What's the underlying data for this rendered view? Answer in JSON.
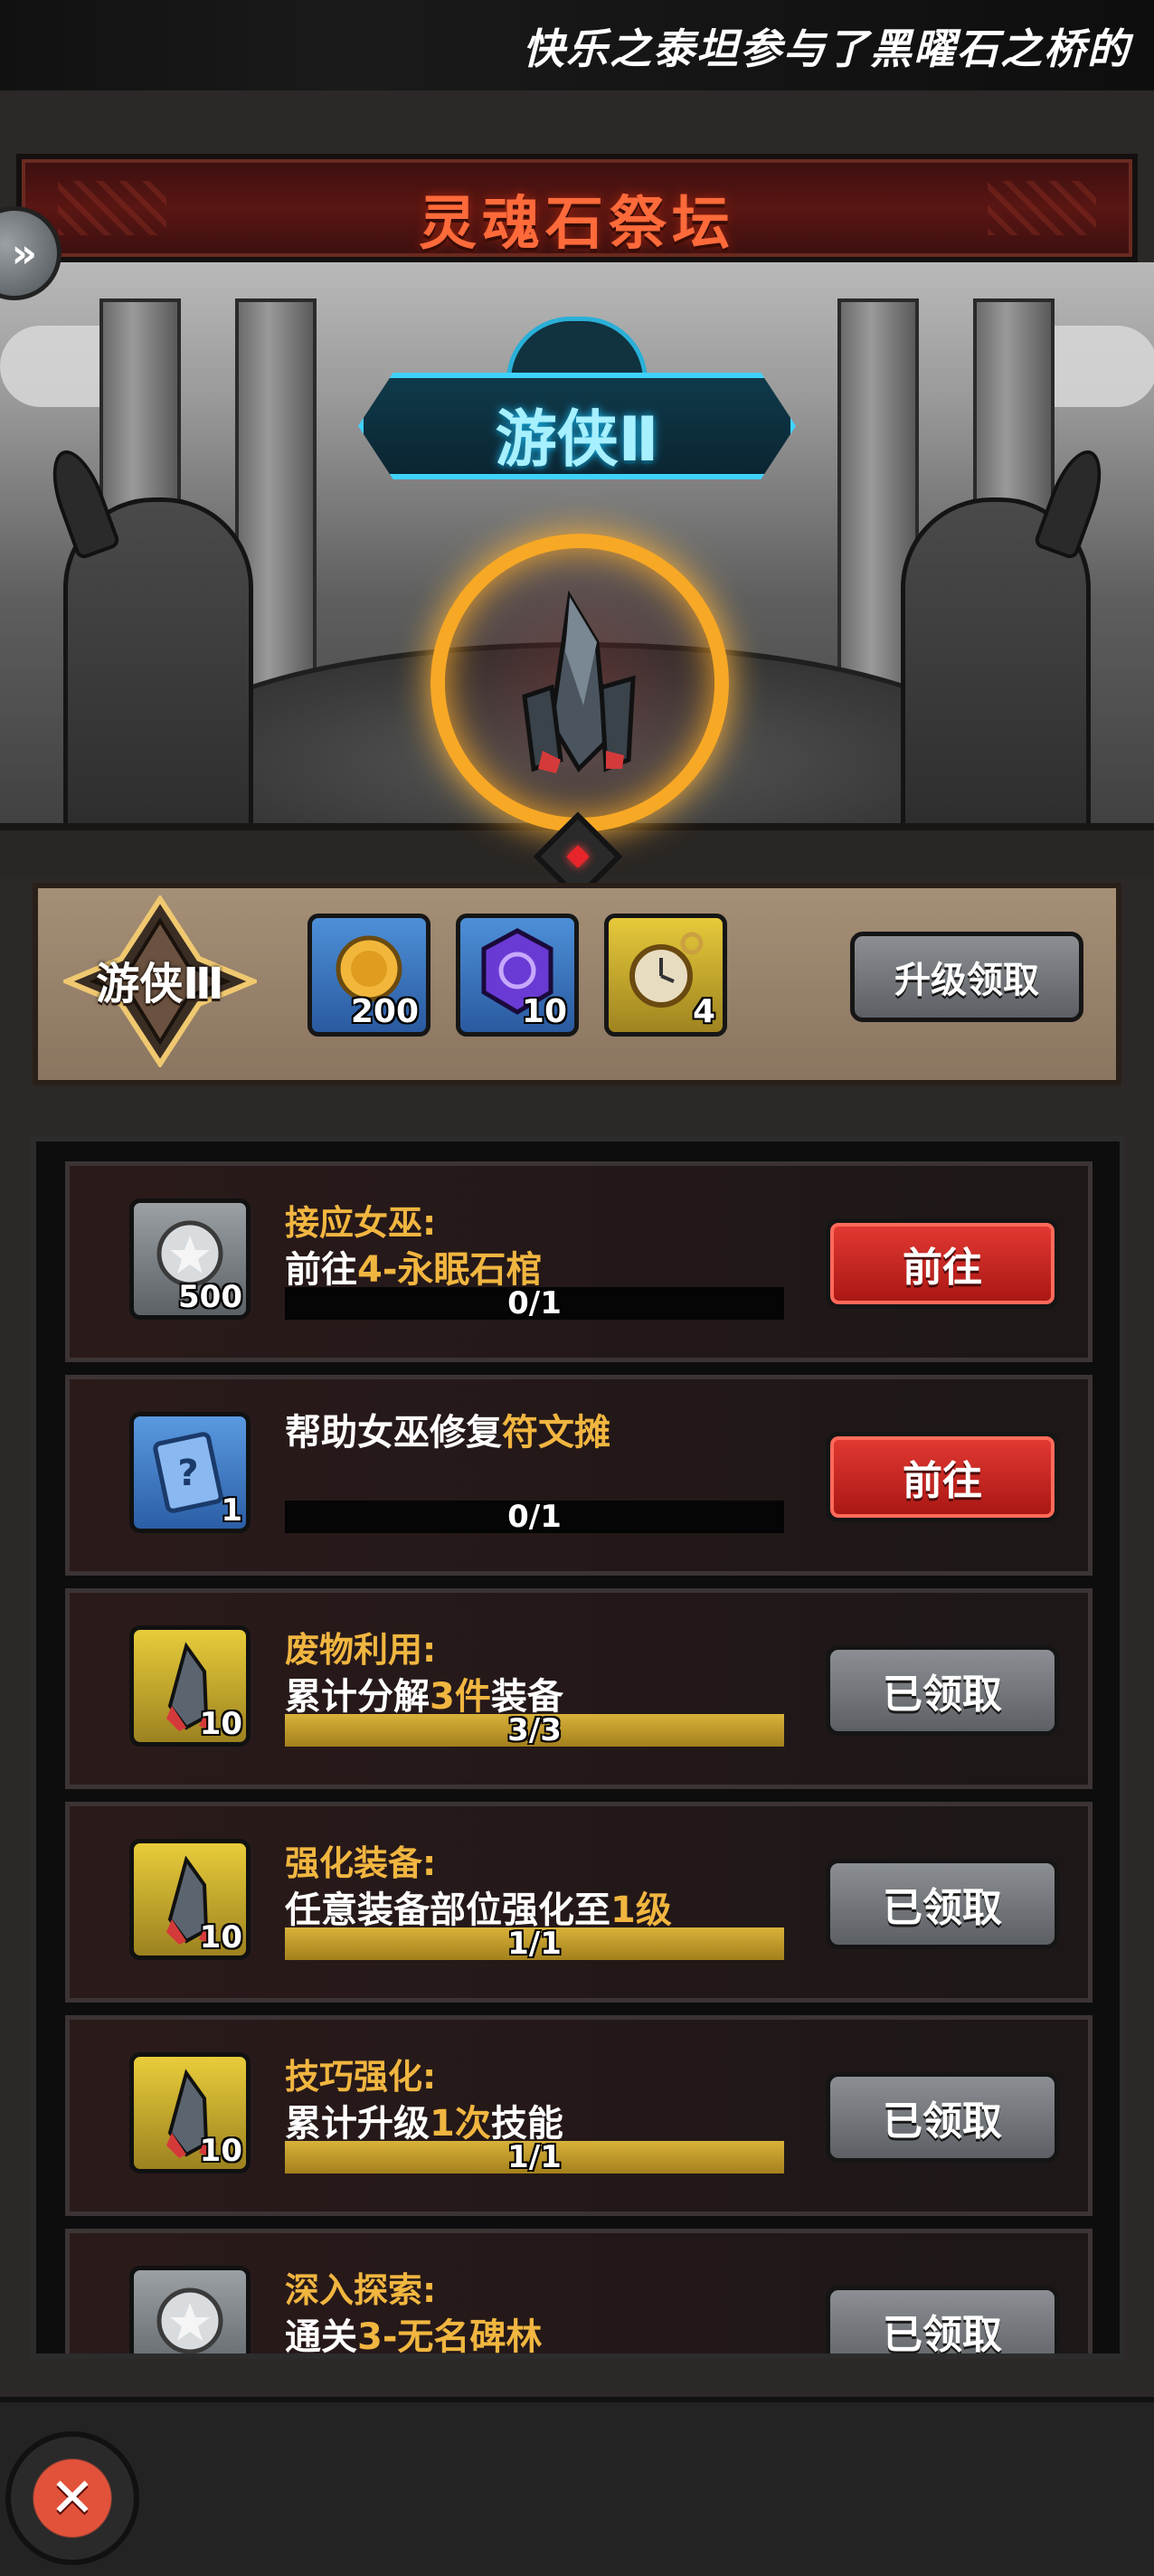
{
  "ticker": {
    "text": "快乐之泰坦参与了黑曜石之桥的"
  },
  "header": {
    "title": "灵魂石祭坛",
    "side_tab_icon": "double-chevron-right-icon"
  },
  "altar": {
    "rank_name": "游侠Ⅱ",
    "ring_color": "#f7a825",
    "badge_color": "#3fd2ff"
  },
  "upgrade": {
    "next_rank": "游侠Ⅲ",
    "rewards": [
      {
        "icon": "gold-coin-icon",
        "count": "200"
      },
      {
        "icon": "purple-rune-stone-icon",
        "count": "10"
      },
      {
        "icon": "pocket-watch-icon",
        "count": "4"
      }
    ],
    "button_label": "升级领取"
  },
  "quests": [
    {
      "icon": "silver-coin-icon",
      "count": "500",
      "title": "接应女巫:",
      "desc_pre": "前往",
      "desc_hl": "4-永眠石棺",
      "desc_post": "",
      "progress": "0/1",
      "fill": 0,
      "button": "前往",
      "button_style": "red"
    },
    {
      "icon": "mystery-card-icon",
      "count": "1",
      "title": "",
      "desc_pre": "帮助女巫修复",
      "desc_hl": "符文摊",
      "desc_post": "",
      "progress": "0/1",
      "fill": 0,
      "button": "前往",
      "button_style": "red"
    },
    {
      "icon": "soul-crystal-icon",
      "count": "10",
      "title": "废物利用:",
      "desc_pre": "累计分解",
      "desc_hl": "3件",
      "desc_post": "装备",
      "progress": "3/3",
      "fill": 1,
      "button": "已领取",
      "button_style": "gray"
    },
    {
      "icon": "soul-crystal-icon",
      "count": "10",
      "title": "强化装备:",
      "desc_pre": "任意装备部位强化至",
      "desc_hl": "1级",
      "desc_post": "",
      "progress": "1/1",
      "fill": 1,
      "button": "已领取",
      "button_style": "gray"
    },
    {
      "icon": "soul-crystal-icon",
      "count": "10",
      "title": "技巧强化:",
      "desc_pre": "累计升级",
      "desc_hl": "1次",
      "desc_post": "技能",
      "progress": "1/1",
      "fill": 1,
      "button": "已领取",
      "button_style": "gray"
    },
    {
      "icon": "silver-coin-icon",
      "count": "",
      "title": "深入探索:",
      "desc_pre": "通关",
      "desc_hl": "3-无名碑林",
      "desc_post": "",
      "progress": "",
      "fill": 1,
      "button": "已领取",
      "button_style": "gray"
    }
  ],
  "footer": {
    "close_icon": "close-icon"
  }
}
